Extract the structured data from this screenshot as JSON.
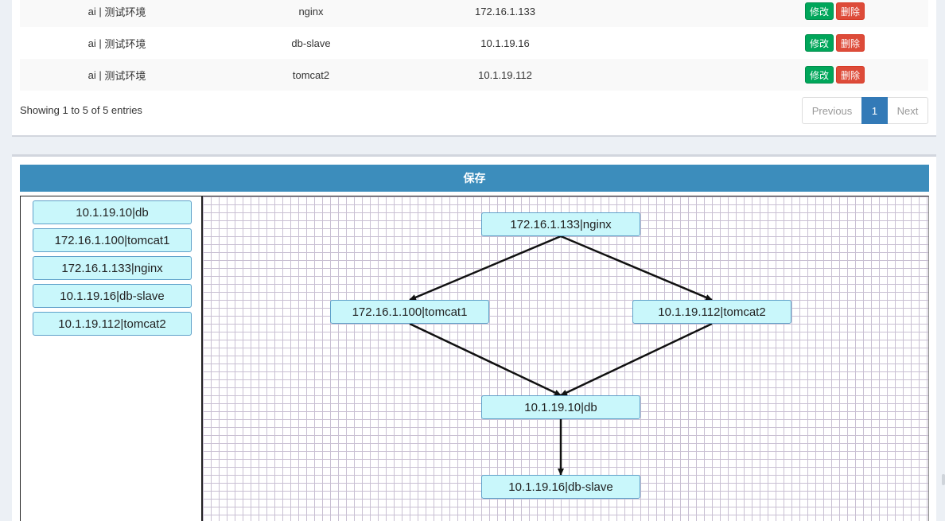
{
  "table": {
    "rows": [
      {
        "env_prefix": "ai",
        "env_sep": " | ",
        "env_name": "测试环境",
        "name": "nginx",
        "ip": "172.16.1.133",
        "edit": "修改",
        "delete": "删除"
      },
      {
        "env_prefix": "ai",
        "env_sep": " | ",
        "env_name": "测试环境",
        "name": "db-slave",
        "ip": "10.1.19.16",
        "edit": "修改",
        "delete": "删除"
      },
      {
        "env_prefix": "ai",
        "env_sep": " | ",
        "env_name": "测试环境",
        "name": "tomcat2",
        "ip": "10.1.19.112",
        "edit": "修改",
        "delete": "删除"
      }
    ],
    "info": "Showing 1 to 5 of 5 entries",
    "pagination": {
      "previous": "Previous",
      "current": "1",
      "next": "Next"
    }
  },
  "topology": {
    "save_label": "保存",
    "palette": [
      "10.1.19.10|db",
      "172.16.1.100|tomcat1",
      "172.16.1.133|nginx",
      "10.1.19.16|db-slave",
      "10.1.19.112|tomcat2"
    ],
    "nodes": {
      "nginx": "172.16.1.133|nginx",
      "tomcat1": "172.16.1.100|tomcat1",
      "tomcat2": "10.1.19.112|tomcat2",
      "db": "10.1.19.10|db",
      "db_slave": "10.1.19.16|db-slave"
    },
    "edges": [
      [
        "nginx",
        "tomcat1"
      ],
      [
        "nginx",
        "tomcat2"
      ],
      [
        "tomcat1",
        "db"
      ],
      [
        "tomcat2",
        "db"
      ],
      [
        "db",
        "db_slave"
      ]
    ],
    "colors": {
      "save_bar": "#3c8dbc",
      "node_fill": "#c9f7fb",
      "edit_button": "#00a65a",
      "delete_button": "#dd4b39"
    }
  }
}
